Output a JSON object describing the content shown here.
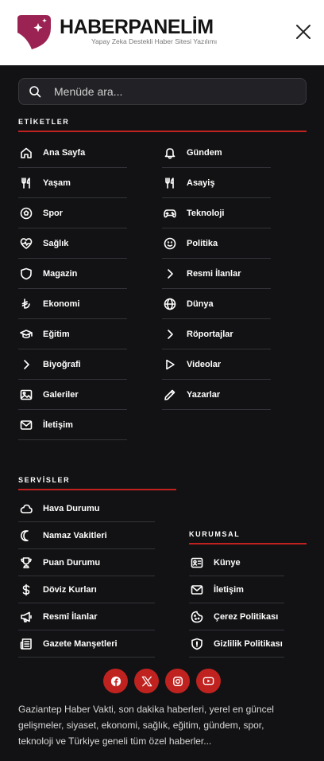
{
  "brand": {
    "name": "HABERPANELİM",
    "tagline": "Yapay Zeka Destekli Haber Sitesi Yazılımı",
    "color": "#9b2353"
  },
  "search": {
    "placeholder": "Menüde ara..."
  },
  "etiketler": {
    "title": "ETİKETLER",
    "left": [
      {
        "label": "Ana Sayfa",
        "icon": "home-icon"
      },
      {
        "label": "Yaşam",
        "icon": "fork-knife-icon"
      },
      {
        "label": "Spor",
        "icon": "football-icon"
      },
      {
        "label": "Sağlık",
        "icon": "heart-pulse-icon"
      },
      {
        "label": "Magazin",
        "icon": "shield-icon"
      },
      {
        "label": "Ekonomi",
        "icon": "lira-icon"
      },
      {
        "label": "Eğitim",
        "icon": "graduation-cap-icon"
      },
      {
        "label": "Biyoğrafi",
        "icon": "chevron-right-icon"
      },
      {
        "label": "Galeriler",
        "icon": "image-icon"
      },
      {
        "label": "İletişim",
        "icon": "mail-icon"
      }
    ],
    "right": [
      {
        "label": "Gündem",
        "icon": "bell-icon"
      },
      {
        "label": "Asayiş",
        "icon": "fork-knife-icon"
      },
      {
        "label": "Teknoloji",
        "icon": "gamepad-icon"
      },
      {
        "label": "Politika",
        "icon": "smile-icon"
      },
      {
        "label": "Resmi İlanlar",
        "icon": "chevron-right-icon"
      },
      {
        "label": "Dünya",
        "icon": "globe-icon"
      },
      {
        "label": "Röportajlar",
        "icon": "chevron-right-icon"
      },
      {
        "label": "Videolar",
        "icon": "play-icon"
      },
      {
        "label": "Yazarlar",
        "icon": "pencil-icon"
      }
    ]
  },
  "servisler": {
    "title": "SERVİSLER",
    "items": [
      {
        "label": "Hava Durumu",
        "icon": "cloud-icon"
      },
      {
        "label": "Namaz Vakitleri",
        "icon": "moon-icon"
      },
      {
        "label": "Puan Durumu",
        "icon": "trophy-icon"
      },
      {
        "label": "Döviz Kurları",
        "icon": "dollar-icon"
      },
      {
        "label": "Resmî İlanlar",
        "icon": "megaphone-icon"
      },
      {
        "label": "Gazete Manşetleri",
        "icon": "newspaper-icon"
      }
    ]
  },
  "kurumsal": {
    "title": "KURUMSAL",
    "items": [
      {
        "label": "Künye",
        "icon": "id-card-icon"
      },
      {
        "label": "İletişim",
        "icon": "mail-icon"
      },
      {
        "label": "Çerez Politikası",
        "icon": "cookie-icon"
      },
      {
        "label": "Gizlilik Politikası",
        "icon": "shield-check-icon"
      }
    ]
  },
  "socials": [
    "facebook-icon",
    "x-icon",
    "instagram-icon",
    "youtube-icon"
  ],
  "description": "Gaziantep Haber Vakti, son dakika haberleri, yerel en güncel gelişmeler, siyaset, ekonomi, sağlık, eğitim, gündem, spor, teknoloji ve Türkiye geneli tüm özel haberler...",
  "colors": {
    "accent": "#c0231f",
    "background": "#121214"
  }
}
